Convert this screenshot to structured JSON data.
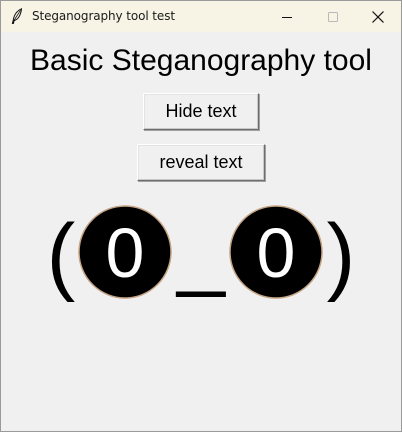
{
  "window": {
    "title": "Steganography tool test"
  },
  "titlebar_icons": {
    "app": "feather-icon",
    "minimize": "minimize-icon",
    "maximize": "maximize-icon",
    "close": "close-icon"
  },
  "main": {
    "heading": "Basic Steganography tool",
    "hide_button_label": "Hide text",
    "reveal_button_label": "reveal text",
    "face": {
      "left_paren": "(",
      "left_eye": "0",
      "mouth": "_",
      "right_eye": "0",
      "right_paren": ")"
    }
  },
  "colors": {
    "window_bg": "#f0f0f0",
    "titlebar_bg": "#f7f4e6",
    "eye_fill": "#000000",
    "eye_text": "#ffffff",
    "eye_outline": "#c4a484"
  }
}
